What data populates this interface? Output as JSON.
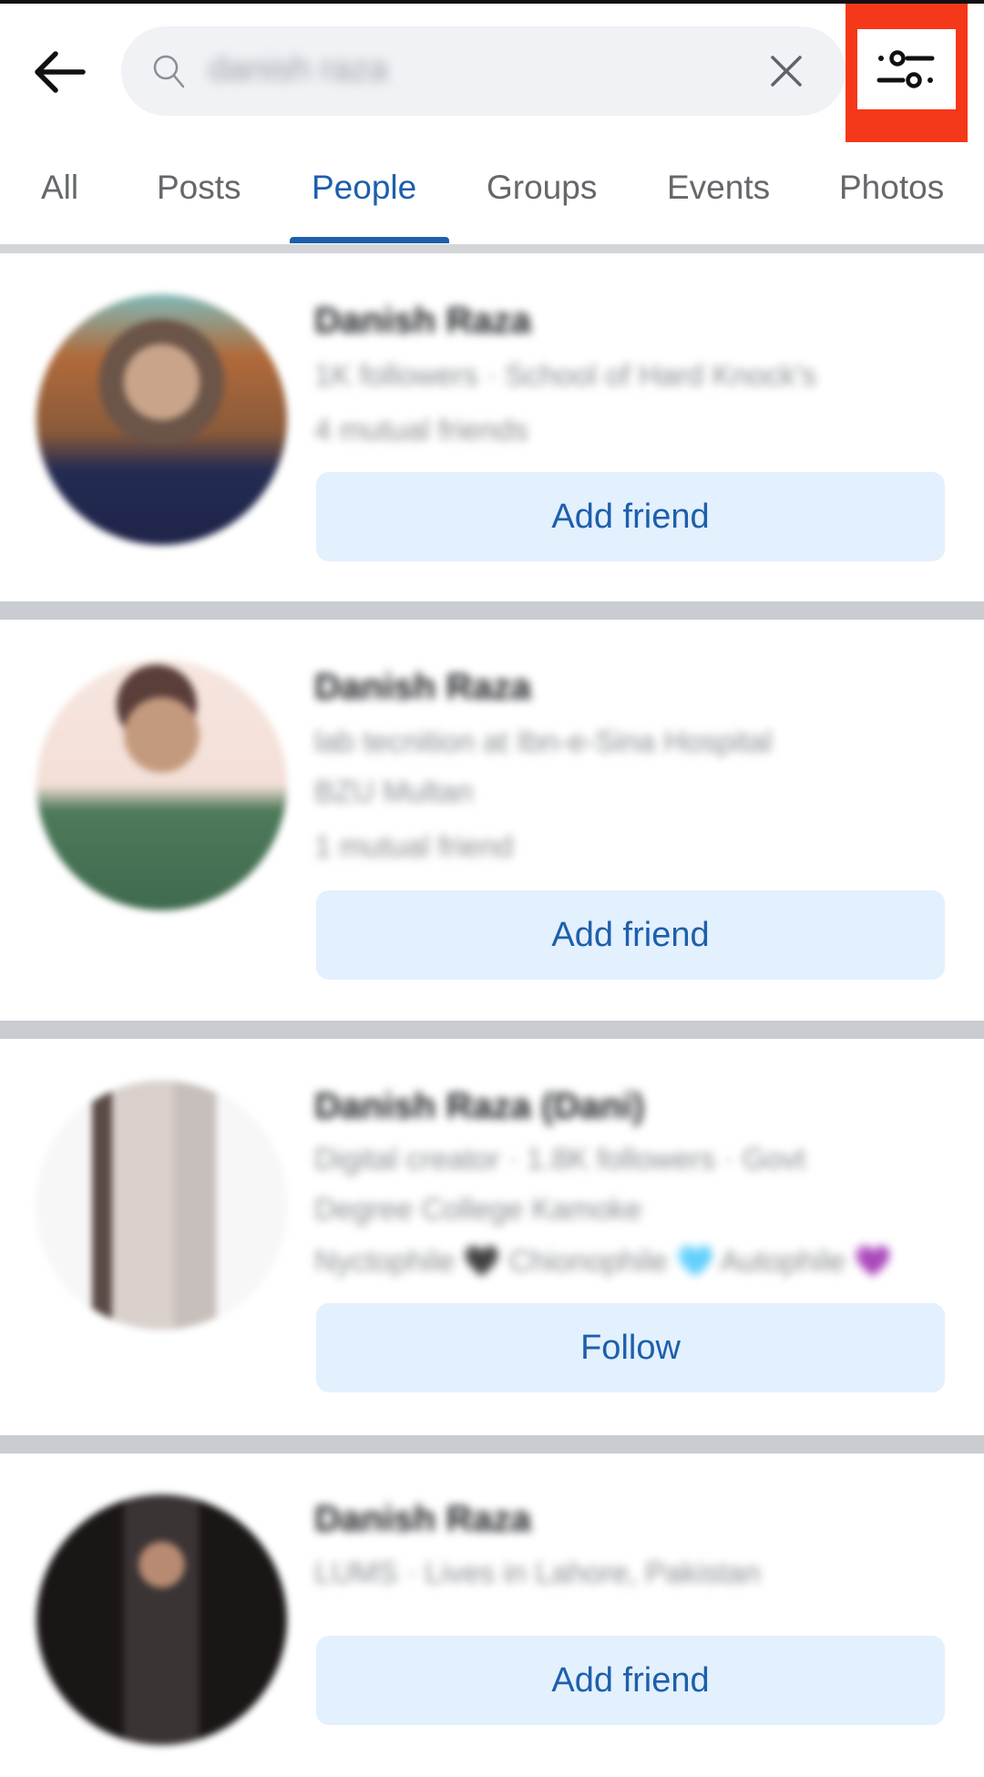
{
  "header": {
    "back_icon": "arrow-left-icon",
    "search": {
      "icon": "search-icon",
      "query": "danish raza",
      "clear_icon": "close-icon"
    },
    "filter_icon": "sliders-filter-icon",
    "highlight_color": "#f5381a"
  },
  "tabs": [
    {
      "label": "All",
      "active": false
    },
    {
      "label": "Posts",
      "active": false
    },
    {
      "label": "People",
      "active": true
    },
    {
      "label": "Groups",
      "active": false
    },
    {
      "label": "Events",
      "active": false
    },
    {
      "label": "Photos",
      "active": false
    }
  ],
  "accent_color": "#1d5fab",
  "results": [
    {
      "name": "Danish Raza",
      "lines": [
        "1K followers · School of Hard Knock's",
        "4 mutual friends"
      ],
      "action": "Add friend"
    },
    {
      "name": "Danish Raza",
      "lines": [
        "lab tecnition at Ibn-e-Sina Hospital",
        "BZU Multan",
        "1 mutual friend"
      ],
      "action": "Add friend"
    },
    {
      "name": "Danish Raza (Dani)",
      "lines": [
        "Digital creator · 1.8K followers · Govt",
        "Degree College Kamoke",
        "Nyctophile 🖤 Chionophile 🩵 Autophile 💜"
      ],
      "action": "Follow"
    },
    {
      "name": "Danish Raza",
      "lines": [
        "LUMS · Lives in Lahore, Pakistan"
      ],
      "action": "Add friend"
    }
  ]
}
